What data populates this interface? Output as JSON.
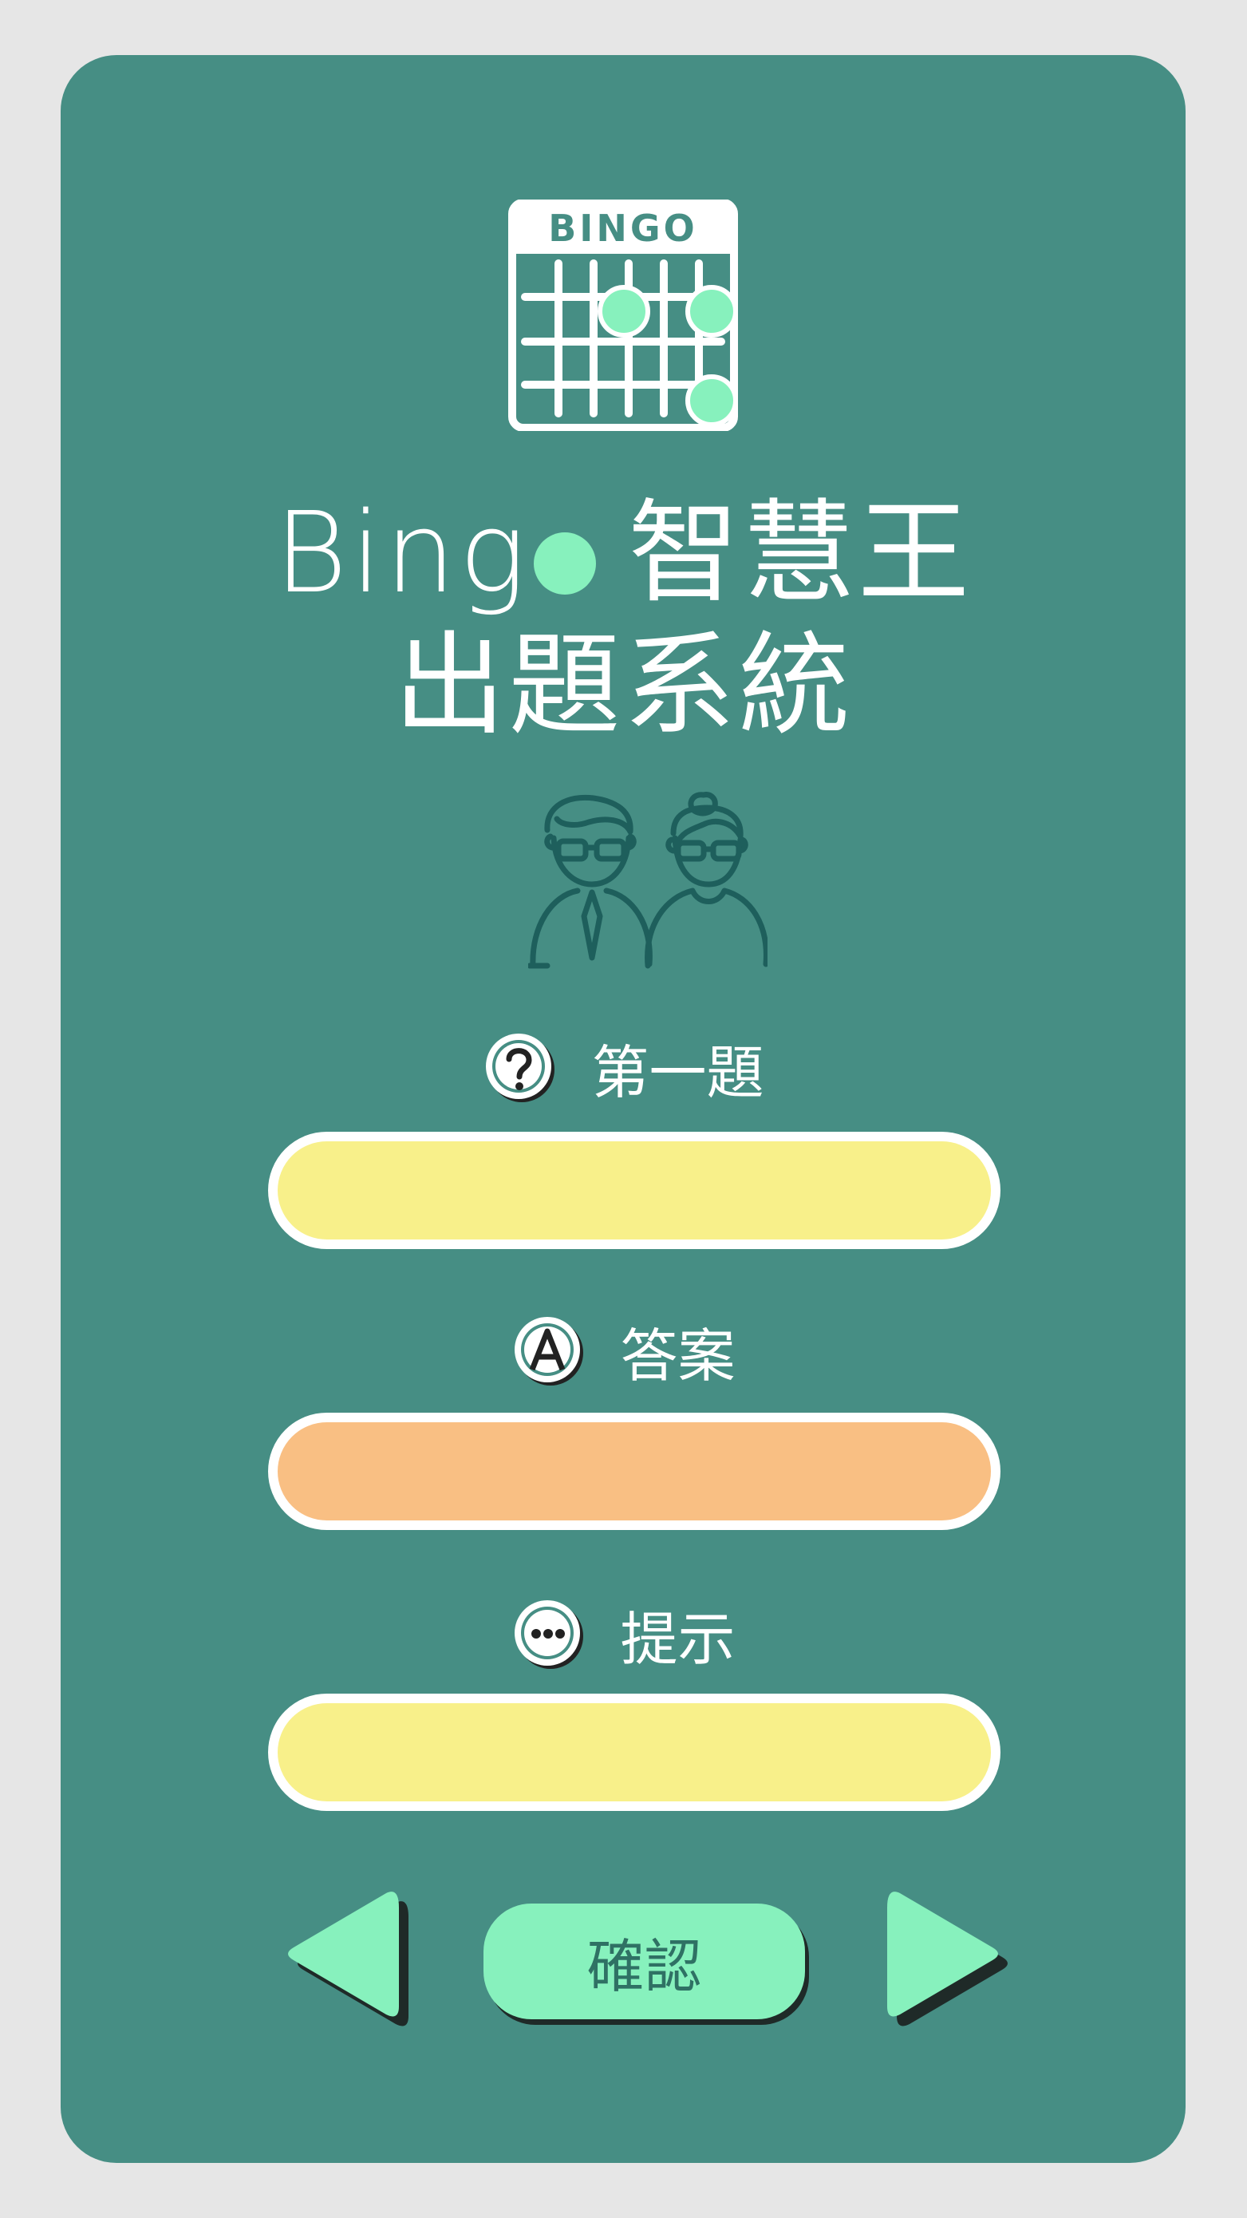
{
  "logo": {
    "text": "BINGO",
    "icon": "bingo-card-icon"
  },
  "title": {
    "line1_prefix": "Bing",
    "line1_suffix": "智慧王",
    "line2": "出題系統"
  },
  "illustration": {
    "icon": "teachers-icon"
  },
  "question": {
    "label": "第一題",
    "icon": "question-icon",
    "value": ""
  },
  "answer": {
    "label": "答案",
    "icon": "letter-a-icon",
    "value": ""
  },
  "hint": {
    "label": "提示",
    "icon": "ellipsis-icon",
    "value": ""
  },
  "controls": {
    "confirm_label": "確認",
    "prev_icon": "triangle-left-icon",
    "next_icon": "triangle-right-icon"
  },
  "colors": {
    "background": "#e6e6e6",
    "card": "#468e84",
    "accent": "#87f1bd",
    "field_yellow": "#f8f08a",
    "field_orange": "#f9bf83"
  }
}
